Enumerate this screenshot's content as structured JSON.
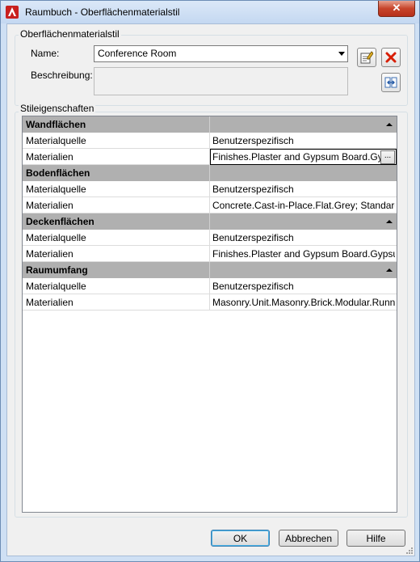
{
  "window": {
    "title": "Raumbuch - Oberflächenmaterialstil",
    "close_symbol": "✕"
  },
  "style_group": {
    "label": "Oberflächenmaterialstil",
    "name_label": "Name:",
    "name_value": "Conference Room",
    "description_label": "Beschreibung:",
    "description_value": ""
  },
  "properties_group": {
    "label": "Stileigenschaften",
    "categories": [
      {
        "title": "Wandflächen",
        "rows": [
          {
            "name": "Materialquelle",
            "value": "Benutzerspezifisch"
          },
          {
            "name": "Materialien",
            "value": "Finishes.Plaster and Gypsum Board.Gypsum",
            "editing": true,
            "button": "..."
          }
        ]
      },
      {
        "title": "Bodenflächen",
        "rows": [
          {
            "name": "Materialquelle",
            "value": "Benutzerspezifisch"
          },
          {
            "name": "Materialien",
            "value": "Concrete.Cast-in-Place.Flat.Grey; Standard"
          }
        ]
      },
      {
        "title": "Deckenflächen",
        "rows": [
          {
            "name": "Materialquelle",
            "value": "Benutzerspezifisch"
          },
          {
            "name": "Materialien",
            "value": "Finishes.Plaster and Gypsum Board.Gypsum"
          }
        ]
      },
      {
        "title": "Raumumfang",
        "rows": [
          {
            "name": "Materialquelle",
            "value": "Benutzerspezifisch"
          },
          {
            "name": "Materialien",
            "value": "Masonry.Unit.Masonry.Brick.Modular.Running"
          }
        ]
      }
    ]
  },
  "buttons": {
    "ok": "OK",
    "cancel": "Abbrechen",
    "help": "Hilfe"
  },
  "icons": {
    "app": "autocad-app-icon",
    "edit_style": "edit-style-icon",
    "delete": "delete-icon",
    "compare": "compare-icon"
  },
  "colors": {
    "title_bar": "#cfe0f4",
    "category_header": "#b0b0b0",
    "close_button": "#c7442b",
    "delete_icon": "#d81e05"
  }
}
